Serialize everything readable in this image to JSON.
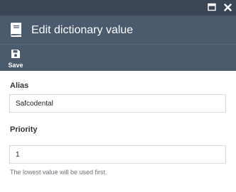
{
  "window": {
    "maximize_icon": "window-maximize-icon",
    "close_icon": "close-icon"
  },
  "header": {
    "icon": "book-icon",
    "title": "Edit dictionary value"
  },
  "toolbar": {
    "save_icon": "floppy-disk-icon",
    "save_label": "Save"
  },
  "form": {
    "alias_label": "Alias",
    "alias_value": "Safcodental",
    "priority_label": "Priority",
    "priority_value": "1",
    "priority_hint": "The lowest value will be used first."
  },
  "colors": {
    "titlebar": "#3b4656",
    "header": "#4c5a6d",
    "field_border": "#d7dbe0",
    "hint_text": "#6e747b"
  }
}
